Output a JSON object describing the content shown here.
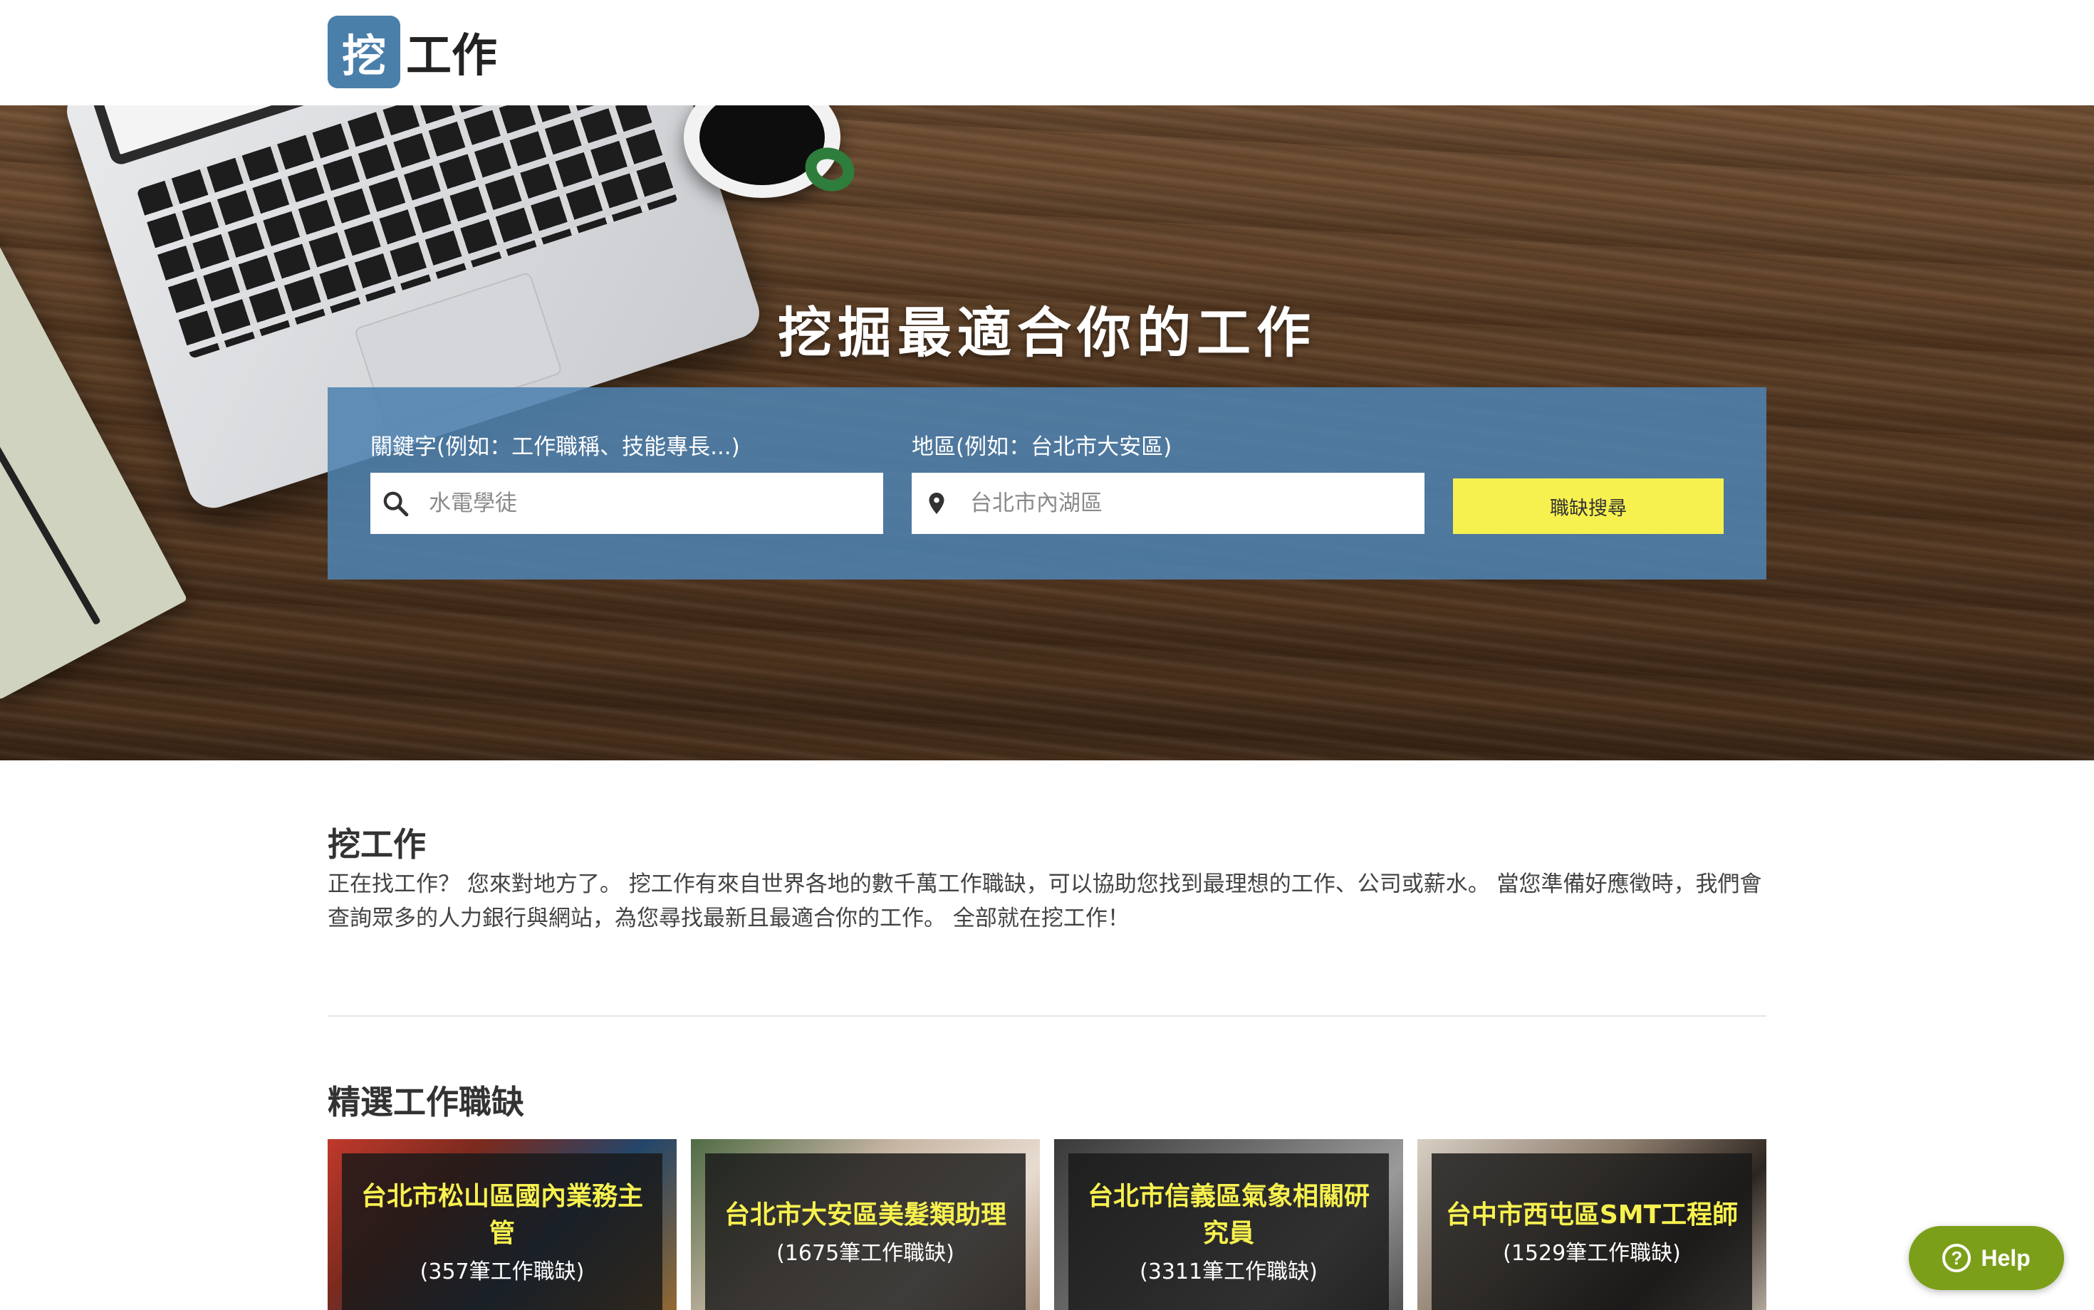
{
  "header": {
    "logo_badge": "挖",
    "logo_text": "工作"
  },
  "hero": {
    "title": "挖掘最適合你的工作",
    "keyword": {
      "label": "關鍵字(例如：工作職稱、技能專長...)",
      "placeholder": "水電學徒",
      "icon": "search-icon"
    },
    "location": {
      "label": "地區(例如：台北市大安區)",
      "placeholder": "台北市內湖區",
      "icon": "location-pin-icon"
    },
    "search_button": "職缺搜尋",
    "search_button_color": "#f7f14f",
    "panel_color": "#4e82af"
  },
  "about": {
    "title": "挖工作",
    "text": "正在找工作？ 您來對地方了。 挖工作有來自世界各地的數千萬工作職缺，可以協助您找到最理想的工作、公司或薪水。 當您準備好應徵時，我們會查詢眾多的人力銀行與網站，為您尋找最新且最適合你的工作。 全部就在挖工作！"
  },
  "featured": {
    "title": "精選工作職缺",
    "cards": [
      {
        "title": "台北市松山區國內業務主管",
        "count": "(357筆工作職缺)"
      },
      {
        "title": "台北市大安區美髮類助理",
        "count": "(1675筆工作職缺)"
      },
      {
        "title": "台北市信義區氣象相關研究員",
        "count": "(3311筆工作職缺)"
      },
      {
        "title": "台中市西屯區SMT工程師",
        "count": "(1529筆工作職缺)"
      }
    ]
  },
  "help": {
    "label": "Help",
    "icon_glyph": "?",
    "color": "#7c9f1a"
  }
}
